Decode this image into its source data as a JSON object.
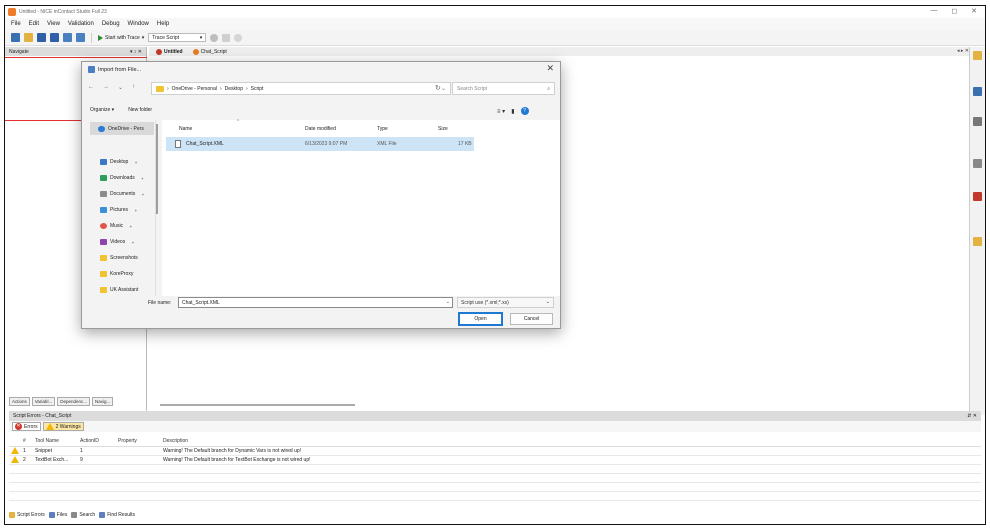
{
  "app": {
    "title": "Untitled - NICE inContact Studio Full 23",
    "controls": [
      "—",
      "◻",
      "✕"
    ]
  },
  "menu": [
    "File",
    "Edit",
    "View",
    "Validation",
    "Debug",
    "Window",
    "Help"
  ],
  "toolbar": {
    "start_label": "Start with Trace",
    "trace_field": "Trace Script",
    "icons": [
      "new-file-icon",
      "open-icon",
      "save-icon",
      "save-all-icon",
      "add-icon",
      "move-icon",
      "play-icon",
      "globe-icon",
      "lock-icon",
      "refresh-icon"
    ]
  },
  "navigate": {
    "title": "Navigate",
    "controls": "▾ ↕ ✕"
  },
  "left_tabs": [
    "Actions",
    "Variabl...",
    "Dependenc...",
    "Navig..."
  ],
  "doc_tabs": {
    "items": [
      "Untitled",
      "Chat_Script"
    ],
    "right": "◂ ▸ ✕"
  },
  "dialog": {
    "title": "Import from File...",
    "close": "✕",
    "nav": [
      "←",
      "→",
      "⌄",
      "↑"
    ],
    "path": [
      "OneDrive - Personal",
      "Desktop",
      "Script"
    ],
    "path_sep": "›",
    "search_placeholder": "Search Script",
    "organize": "Organize ▾",
    "new_folder": "New folder",
    "sidebar": [
      {
        "label": "OneDrive - Pers",
        "icon": "cloud-icon",
        "color": "#2b7cd3"
      },
      {
        "label": "Desktop",
        "icon": "desktop-icon",
        "color": "#3c78c8"
      },
      {
        "label": "Downloads",
        "icon": "download-icon",
        "color": "#2e9e5b"
      },
      {
        "label": "Documents",
        "icon": "document-icon",
        "color": "#8c8c8c"
      },
      {
        "label": "Pictures",
        "icon": "picture-icon",
        "color": "#3b8fd8"
      },
      {
        "label": "Music",
        "icon": "music-icon",
        "color": "#e0564a"
      },
      {
        "label": "Videos",
        "icon": "video-icon",
        "color": "#8e44ad"
      },
      {
        "label": "Screenshots",
        "icon": "folder-icon",
        "color": "#f1c232"
      },
      {
        "label": "KoreProxy",
        "icon": "folder-icon",
        "color": "#f1c232"
      },
      {
        "label": "UK Assistant",
        "icon": "folder-icon",
        "color": "#f1c232"
      }
    ],
    "columns": [
      "Name",
      "Date modified",
      "Type",
      "Size"
    ],
    "files": [
      {
        "name": "Chat_Script.XML",
        "date": "6/13/2023 9:07 PM",
        "type": "XML File",
        "size": "17 KB"
      }
    ],
    "file_name_label": "File name:",
    "file_name_value": "Chat_Script.XML",
    "file_type": "Script use (*.xml;*.xs)",
    "open_label": "Open",
    "cancel_label": "Cancel"
  },
  "errors": {
    "title": "Script Errors - Chat_Script",
    "header_controls": "⇵ ✕",
    "tab_errors": "Errors",
    "tab_warnings": "2 Warnings",
    "columns": [
      "#",
      "Tool Name",
      "ActionID",
      "Property",
      "Description"
    ],
    "rows": [
      {
        "num": "1",
        "tool": "Snippet",
        "action": "1",
        "property": "",
        "desc": "Warning! The Default branch for Dynamic Vars is not wired up!"
      },
      {
        "num": "2",
        "tool": "TextBot Exch...",
        "action": "9",
        "property": "",
        "desc": "Warning! The Default branch for TextBot Exchange is not wired up!"
      }
    ]
  },
  "bottom_tabs": [
    "Script Errors",
    "Files",
    "Search",
    "Find Results"
  ],
  "colors": {
    "accent": "#1f78d1",
    "selection": "#cde4f7",
    "warning": "#f2b705",
    "error": "#d0362d"
  }
}
